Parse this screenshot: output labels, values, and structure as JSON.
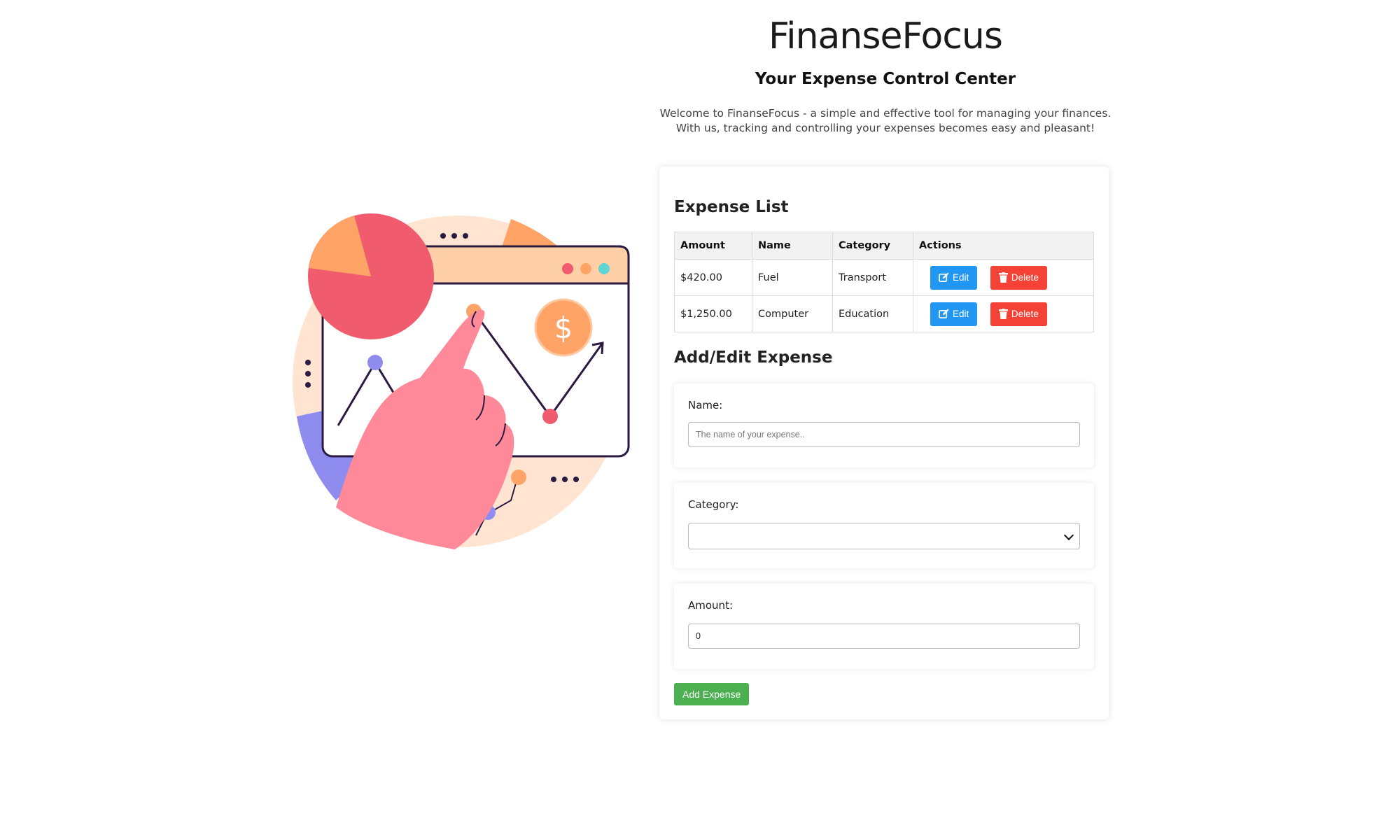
{
  "header": {
    "title": "FinanseFocus",
    "subtitle": "Your Expense Control Center",
    "intro": "Welcome to FinanseFocus - a simple and effective tool for managing your finances. With us, tracking and controlling your expenses becomes easy and pleasant!"
  },
  "illustration": {
    "icon": "finance-chart-illustration-icon",
    "currency_symbol": "$",
    "colors": {
      "coral": "#f05b6e",
      "orange": "#ffa366",
      "peach": "#ffe4d2",
      "purple": "#8f8cf0",
      "pink": "#ff8899",
      "navy": "#2b1a40"
    }
  },
  "expense_list": {
    "title": "Expense List",
    "columns": [
      "Amount",
      "Name",
      "Category",
      "Actions"
    ],
    "rows": [
      {
        "amount": "$420.00",
        "name": "Fuel",
        "category": "Transport"
      },
      {
        "amount": "$1,250.00",
        "name": "Computer",
        "category": "Education"
      }
    ],
    "edit_label": "Edit",
    "delete_label": "Delete",
    "edit_icon": "edit-icon",
    "delete_icon": "trash-icon",
    "colors": {
      "edit": "#2196f3",
      "delete": "#f44336"
    }
  },
  "form": {
    "title": "Add/Edit Expense",
    "name_label": "Name:",
    "name_placeholder": "The name of your expense..",
    "name_value": "",
    "category_label": "Category:",
    "category_value": "",
    "amount_label": "Amount:",
    "amount_value": "0",
    "submit_label": "Add Expense",
    "submit_color": "#4caf50"
  }
}
